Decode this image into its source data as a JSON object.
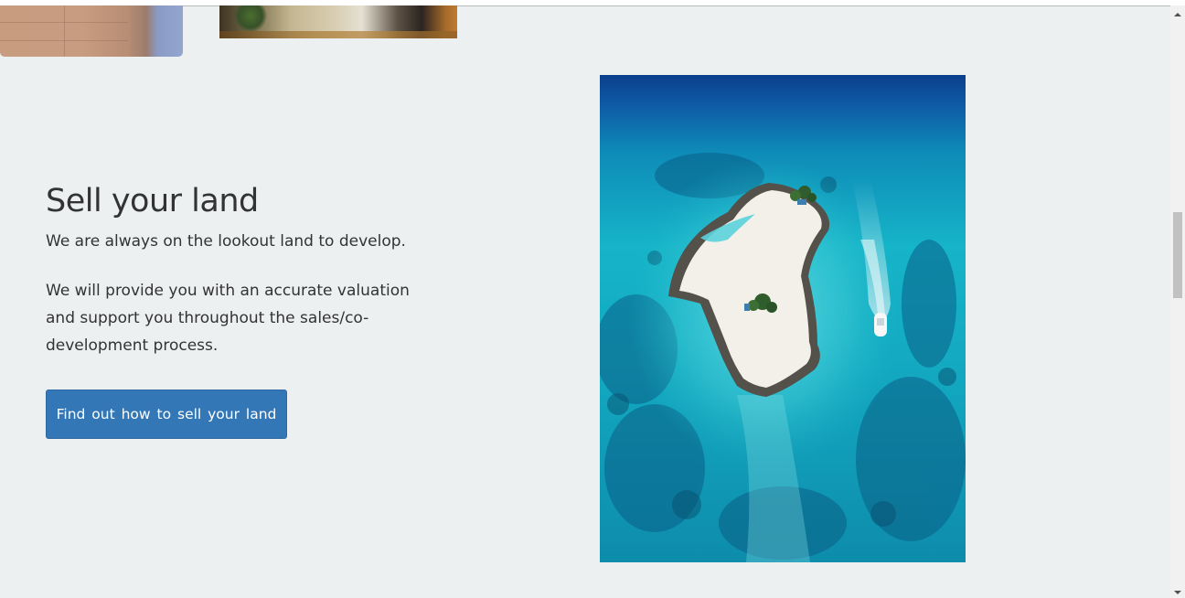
{
  "section": {
    "heading": "Sell your land",
    "lead": "We are always on the lookout land to develop.",
    "body": "We will provide you with an accurate valuation and support you throughout the sales/co-development process.",
    "cta_label": "Find out how to sell your land"
  },
  "images": {
    "top_left": "interior-floor-photo",
    "top_middle": "living-room-photo",
    "feature": "aerial-island-photo"
  },
  "colors": {
    "page_background": "#edf0f1",
    "button_background": "#3377b7",
    "text": "#333333"
  },
  "scrollbar": {
    "up_icon": "scroll-up-arrow",
    "down_icon": "scroll-down-arrow"
  }
}
